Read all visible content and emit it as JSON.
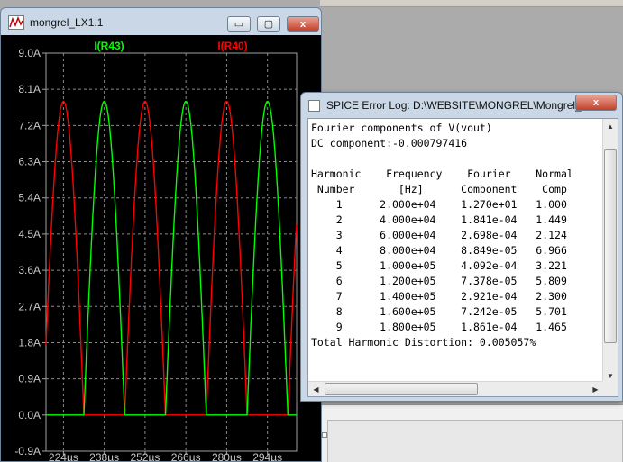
{
  "plot_window": {
    "title": "mongrel_LX1.1",
    "buttons": {
      "minimize": "▭",
      "restore": "▢",
      "close": "x"
    }
  },
  "chart_data": {
    "type": "line",
    "series": [
      {
        "name": "I(R43)",
        "color": "#00ff00"
      },
      {
        "name": "I(R40)",
        "color": "#ff0000"
      }
    ],
    "x_unit": "µs",
    "x_ticks": [
      "224µs",
      "238µs",
      "252µs",
      "266µs",
      "280µs",
      "294µs"
    ],
    "y_ticks": [
      "9.0A",
      "8.1A",
      "7.2A",
      "6.3A",
      "5.4A",
      "4.5A",
      "3.6A",
      "2.7A",
      "1.8A",
      "0.9A",
      "0.0A",
      "-0.9A"
    ],
    "xlim": [
      218,
      304
    ],
    "ylim": [
      -0.9,
      9.0
    ],
    "peak_current": 7.8,
    "half_period_us": 14,
    "grid": true
  },
  "log_window": {
    "title": "SPICE Error Log: D:\\WEBSITE\\MONGREL\\Mongrel_...",
    "close": "x",
    "lines": [
      "Fourier components of V(vout)",
      "DC component:-0.000797416",
      "",
      "Harmonic    Frequency    Fourier    Normal",
      " Number       [Hz]      Component    Comp",
      "    1      2.000e+04    1.270e+01   1.000",
      "    2      4.000e+04    1.841e-04   1.449",
      "    3      6.000e+04    2.698e-04   2.124",
      "    4      8.000e+04    8.849e-05   6.966",
      "    5      1.000e+05    4.092e-04   3.221",
      "    6      1.200e+05    7.378e-05   5.809",
      "    7      1.400e+05    2.921e-04   2.300",
      "    8      1.600e+05    7.242e-05   5.701",
      "    9      1.800e+05    1.861e-04   1.465",
      "Total Harmonic Distortion: 0.005057%"
    ],
    "scroll": {
      "up": "▲",
      "down": "▼",
      "left": "◀",
      "right": "▶",
      "grip": "⁞⁞⁞"
    }
  }
}
